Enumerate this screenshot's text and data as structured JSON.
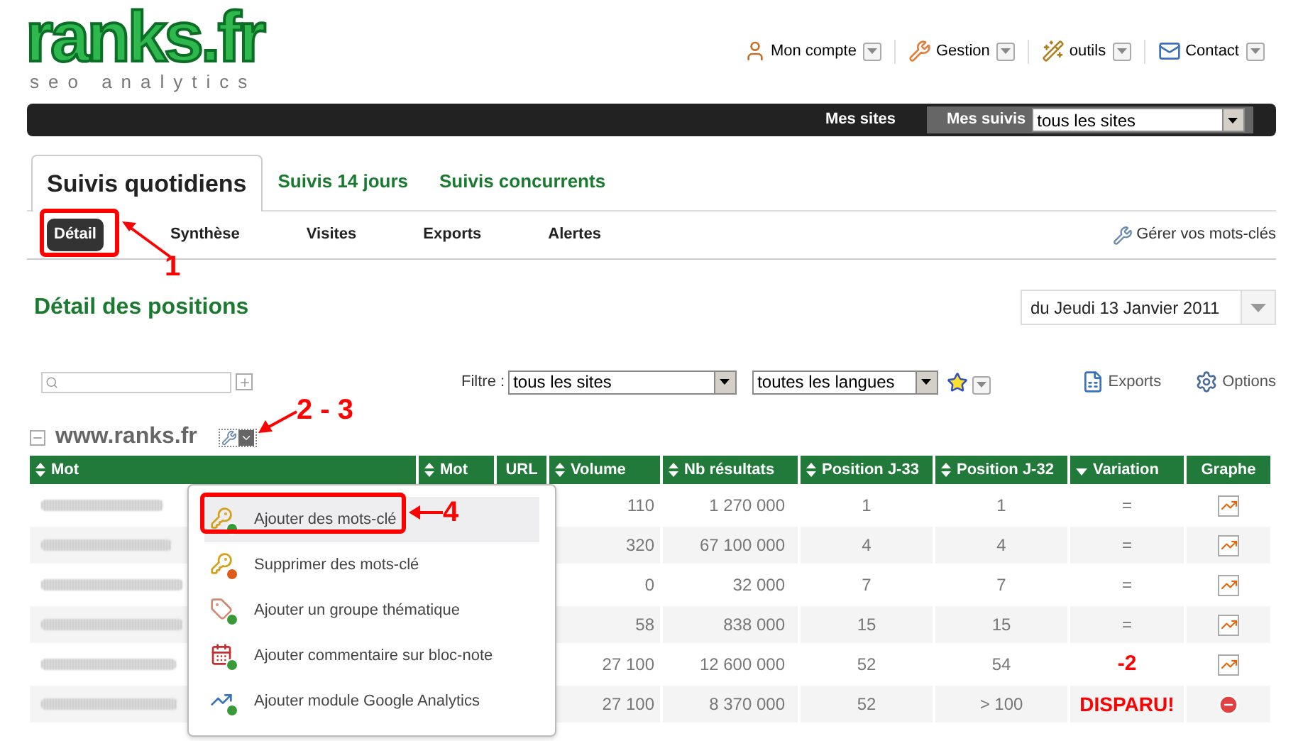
{
  "header": {
    "logo": {
      "name": "ranks.fr",
      "tagline": "seo analytics"
    },
    "menu": [
      {
        "label": "Mon compte",
        "kind": "user"
      },
      {
        "label": "Gestion",
        "kind": "wrench"
      },
      {
        "label": "outils",
        "kind": "wand"
      },
      {
        "label": "Contact",
        "kind": "mail"
      }
    ]
  },
  "top_bar": {
    "link": "Mes sites",
    "suivis_label": "Mes suivis",
    "suivis_select": "tous les sites"
  },
  "tabs": [
    {
      "label": "Suivis quotidiens",
      "selected": true
    },
    {
      "label": "Suivis 14 jours",
      "selected": false
    },
    {
      "label": "Suivis concurrents",
      "selected": false
    }
  ],
  "subnav": [
    {
      "label": "Détail",
      "selected": true
    },
    {
      "label": "Synthèse",
      "selected": false
    },
    {
      "label": "Visites",
      "selected": false
    },
    {
      "label": "Exports",
      "selected": false
    },
    {
      "label": "Alertes",
      "selected": false
    }
  ],
  "manage_link": "Gérer vos mots-clés",
  "title": "Détail des positions",
  "date": "du Jeudi 13 Janvier 2011",
  "toolbar": {
    "filter_label": "Filtre :",
    "site_filter": "tous les sites",
    "language_filter": "toutes les langues",
    "exports": "Exports",
    "options": "Options"
  },
  "site": "www.ranks.fr",
  "table": {
    "columns": [
      {
        "label": "Mot",
        "kind": "sortable"
      },
      {
        "label": "Mot",
        "kind": "sortable"
      },
      {
        "label": "URL",
        "kind": "plain"
      },
      {
        "label": "Volume",
        "kind": "sortable"
      },
      {
        "label": "Nb résultats",
        "kind": "sortable"
      },
      {
        "label": "Position J-33",
        "kind": "sortable"
      },
      {
        "label": "Position J-32",
        "kind": "sortable"
      },
      {
        "label": "Variation",
        "kind": "descending"
      },
      {
        "label": "Graphe",
        "kind": "plain"
      }
    ],
    "rows": [
      {
        "volume": "110",
        "results": "1 270 000",
        "pos_j33": "1",
        "pos_j32": "1",
        "variation": "=",
        "kind": "same"
      },
      {
        "volume": "320",
        "results": "67 100 000",
        "pos_j33": "4",
        "pos_j32": "4",
        "variation": "=",
        "kind": "same"
      },
      {
        "volume": "0",
        "results": "32 000",
        "pos_j33": "7",
        "pos_j32": "7",
        "variation": "=",
        "kind": "same"
      },
      {
        "volume": "58",
        "results": "838 000",
        "pos_j33": "15",
        "pos_j32": "15",
        "variation": "=",
        "kind": "same"
      },
      {
        "volume": "27 100",
        "results": "12 600 000",
        "pos_j33": "52",
        "pos_j32": "54",
        "variation": "-2",
        "kind": "drop"
      },
      {
        "volume": "27 100",
        "results": "8 370 000",
        "pos_j33": "52",
        "pos_j32": "> 100",
        "variation": "DISPARU!",
        "kind": "gone"
      }
    ]
  },
  "menu": {
    "items": [
      {
        "label": "Ajouter des mots-clé",
        "kind": "add-keyword",
        "selected": true
      },
      {
        "label": "Supprimer des mots-clé",
        "kind": "remove-keyword",
        "selected": false
      },
      {
        "label": "Ajouter un groupe thématique",
        "kind": "group",
        "selected": false
      },
      {
        "label": "Ajouter commentaire sur bloc-note",
        "kind": "note",
        "selected": false
      },
      {
        "label": "Ajouter module Google Analytics",
        "kind": "analytics",
        "selected": false
      }
    ]
  },
  "annotations": [
    "1",
    "2 - 3",
    "4"
  ]
}
